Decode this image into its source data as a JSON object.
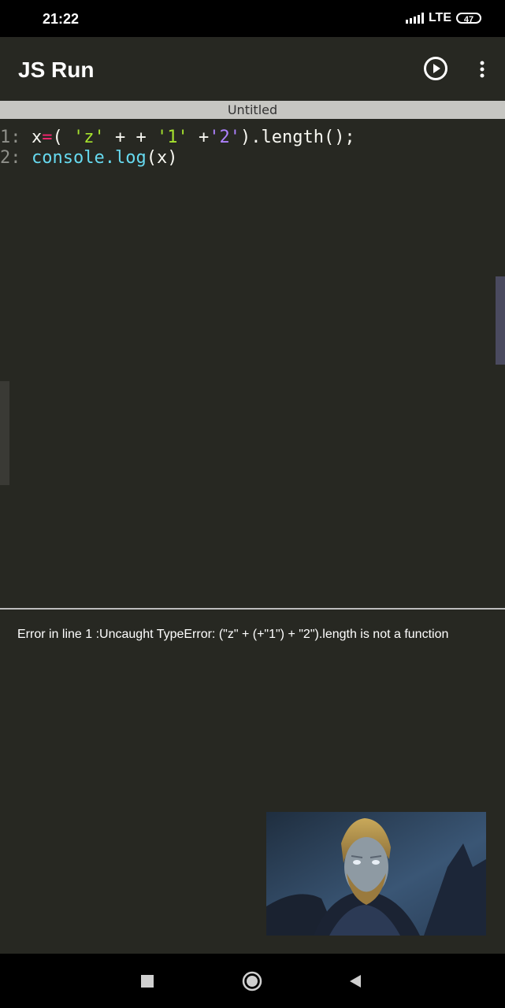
{
  "status_bar": {
    "time": "21:22",
    "network": "LTE",
    "battery": "47"
  },
  "app": {
    "title": "JS Run"
  },
  "tab": {
    "filename": "Untitled"
  },
  "editor": {
    "lines": [
      {
        "number": "1:",
        "tokens": [
          {
            "text": "x",
            "kind": "plain"
          },
          {
            "text": "=",
            "kind": "op"
          },
          {
            "text": "( ",
            "kind": "plain"
          },
          {
            "text": "'z'",
            "kind": "str"
          },
          {
            "text": " + + ",
            "kind": "plain"
          },
          {
            "text": "'1'",
            "kind": "str"
          },
          {
            "text": " +",
            "kind": "plain"
          },
          {
            "text": "'2'",
            "kind": "num"
          },
          {
            "text": ").length();",
            "kind": "plain"
          }
        ]
      },
      {
        "number": "2:",
        "tokens": [
          {
            "text": "console.log",
            "kind": "fn"
          },
          {
            "text": "(x)",
            "kind": "plain"
          }
        ]
      }
    ]
  },
  "console": {
    "output": "Error in line 1 :Uncaught TypeError: (\"z\" + (+\"1\") + \"2\").length is not a function"
  },
  "colors": {
    "background": "#272822",
    "tab_bar": "#c6c6c2",
    "keyword_red": "#f92672",
    "string_green": "#a6e22e",
    "number_purple": "#ae81ff",
    "function_blue": "#66d9ef"
  },
  "icons": {
    "run": "play-circle-icon",
    "menu": "more-vert-icon",
    "nav_recents": "square-icon",
    "nav_home": "circle-icon",
    "nav_back": "triangle-back-icon"
  }
}
